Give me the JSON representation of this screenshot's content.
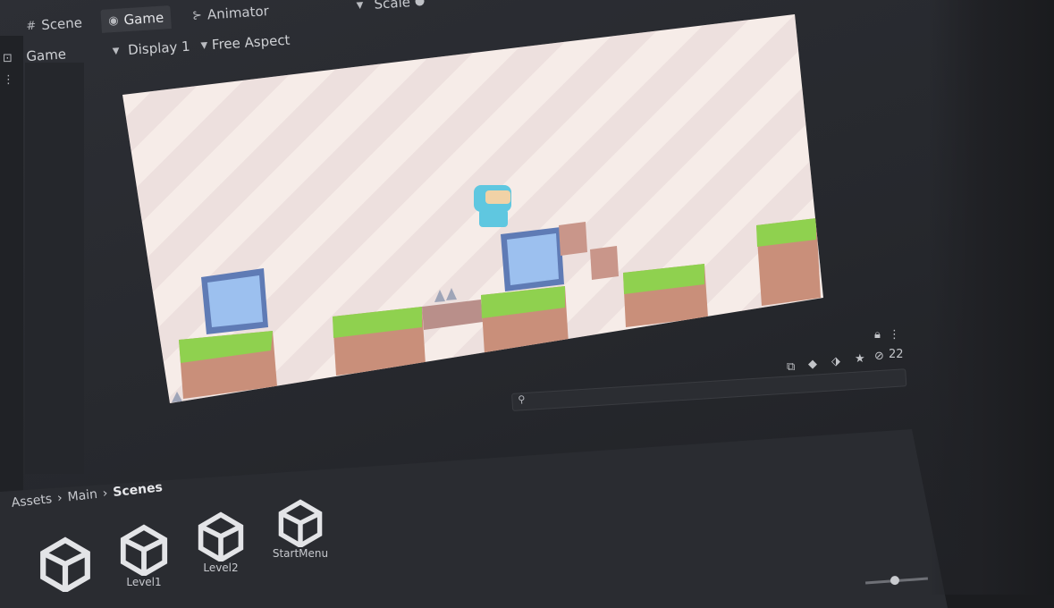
{
  "tabs": [
    {
      "label": "Scene",
      "icon": "grid-icon"
    },
    {
      "label": "Game",
      "icon": "gamepad-icon",
      "active": true
    },
    {
      "label": "Animator",
      "icon": "animator-icon"
    }
  ],
  "scale": {
    "label": "Scale"
  },
  "toolbar": {
    "view_select": "Game",
    "display_select": "Display 1",
    "aspect_select": "Free Aspect"
  },
  "project_panel": {
    "breadcrumb": [
      "Assets",
      "Main",
      "Scenes"
    ],
    "assets": [
      {
        "label": "",
        "icon": "unity-scene-icon"
      },
      {
        "label": "Level1",
        "icon": "unity-scene-icon"
      },
      {
        "label": "Level2",
        "icon": "unity-scene-icon"
      },
      {
        "label": "StartMenu",
        "icon": "unity-scene-icon"
      }
    ],
    "hidden_count": "22"
  },
  "colors": {
    "editor_bg": "#2a2c31",
    "game_bg": "#f6ece8",
    "grass": "#8fd14f",
    "dirt": "#c98f7a",
    "block_blue": "#8fb6e8",
    "player": "#5fc7e0"
  }
}
